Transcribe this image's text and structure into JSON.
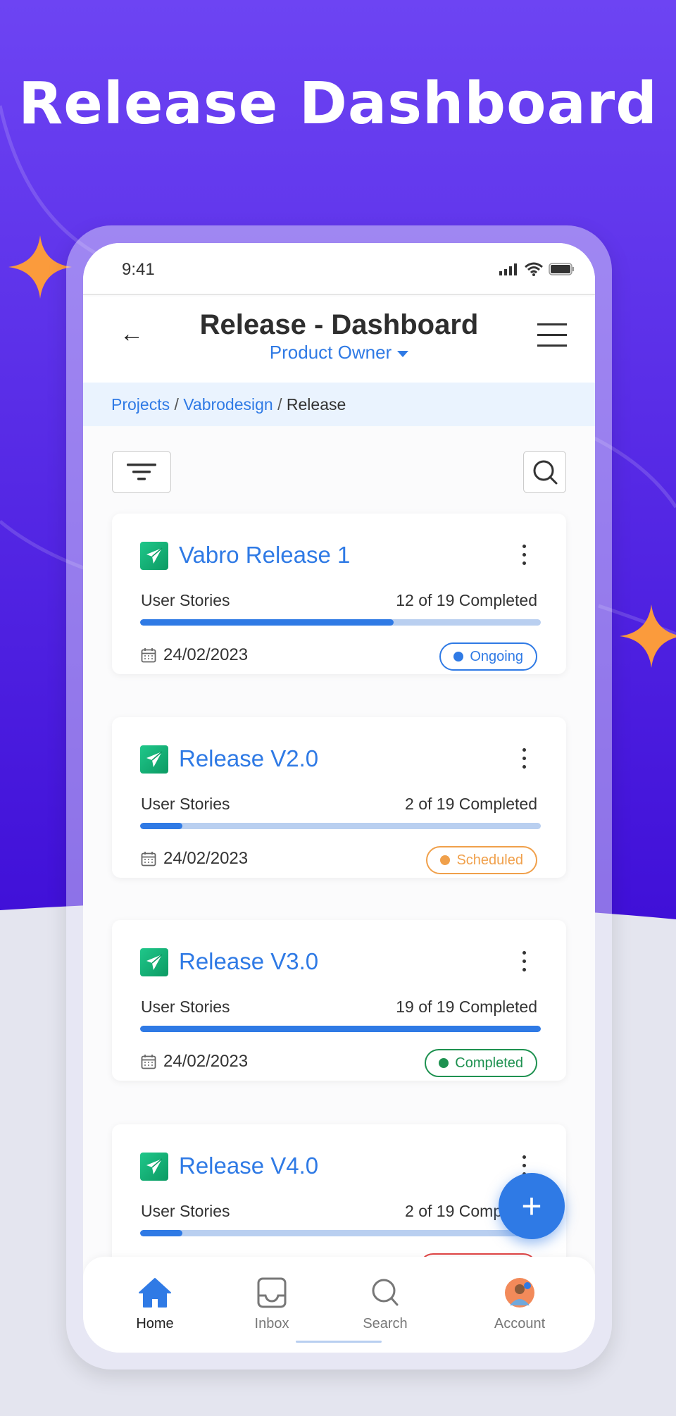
{
  "hero_title": "Release Dashboard",
  "status_bar": {
    "time": "9:41"
  },
  "header": {
    "title": "Release - Dashboard",
    "role": "Product Owner"
  },
  "breadcrumb": {
    "items": [
      "Projects",
      "Vabrodesign",
      "Release"
    ],
    "separator": "/"
  },
  "releases": [
    {
      "name": "Vabro Release 1",
      "label": "User Stories",
      "completed": 12,
      "total": 19,
      "count_text": "12 of 19 Completed",
      "date": "24/02/2023",
      "status": "Ongoing",
      "status_color": "#2f7ae5"
    },
    {
      "name": "Release V2.0",
      "label": "User Stories",
      "completed": 2,
      "total": 19,
      "count_text": "2 of 19 Completed",
      "date": "24/02/2023",
      "status": "Scheduled",
      "status_color": "#f0a04b"
    },
    {
      "name": "Release V3.0",
      "label": "User Stories",
      "completed": 19,
      "total": 19,
      "count_text": "19 of 19 Completed",
      "date": "24/02/2023",
      "status": "Completed",
      "status_color": "#1e9150"
    },
    {
      "name": "Release V4.0",
      "label": "User Stories",
      "completed": 2,
      "total": 19,
      "count_text": "2 of 19 Completed",
      "date": "",
      "status": "",
      "status_color": "#e04545"
    }
  ],
  "bottom_nav": [
    {
      "label": "Home",
      "icon": "home-icon",
      "active": true
    },
    {
      "label": "Inbox",
      "icon": "inbox-icon"
    },
    {
      "label": "Search",
      "icon": "search-icon"
    },
    {
      "label": "Account",
      "icon": "avatar"
    }
  ],
  "colors": {
    "accent": "#2f7ae5",
    "background_top": "#6d44f3",
    "background_bottom": "#4010d8",
    "sparkle": "#fb9b3c"
  }
}
